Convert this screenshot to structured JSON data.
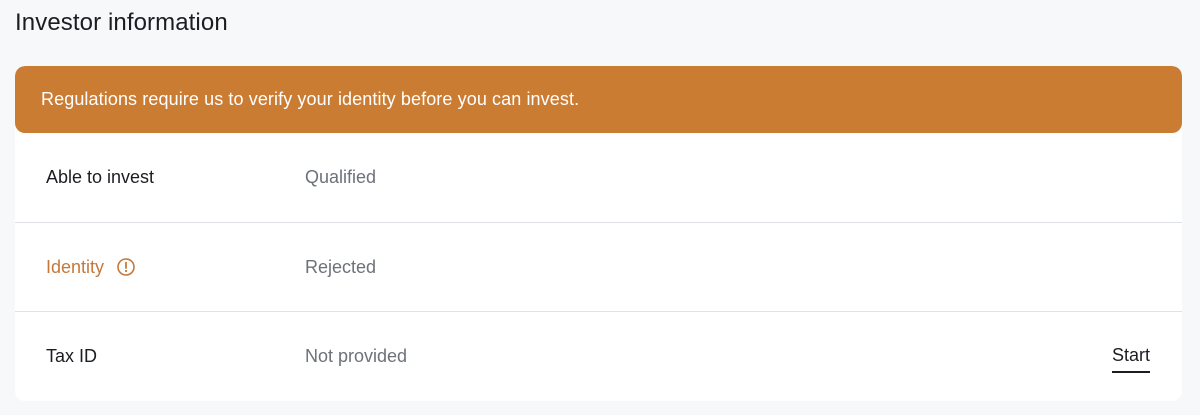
{
  "page": {
    "title": "Investor information"
  },
  "alert": {
    "message": "Regulations require us to verify your identity before you can invest."
  },
  "rows": [
    {
      "label": "Able to invest",
      "value": "Qualified"
    },
    {
      "label": "Identity",
      "value": "Rejected",
      "icon": "info-circle-icon"
    },
    {
      "label": "Tax ID",
      "value": "Not provided",
      "action": "Start"
    }
  ],
  "colors": {
    "alert_background": "#cb7c33",
    "warning_text": "#c5783a",
    "page_background": "#f7f8fa"
  }
}
